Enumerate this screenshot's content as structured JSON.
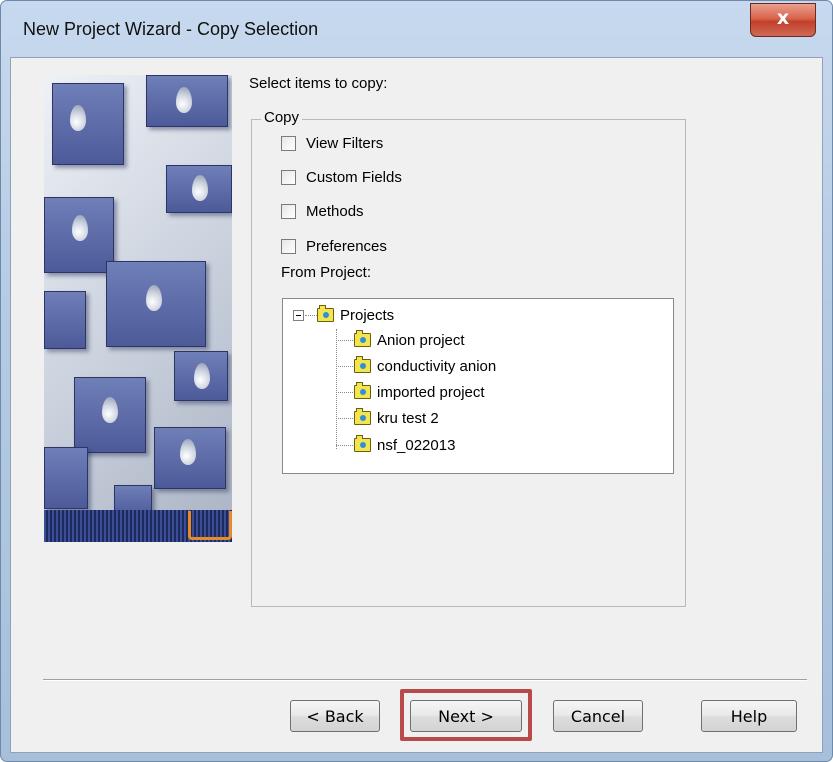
{
  "window": {
    "title": "New Project Wizard - Copy Selection",
    "close_glyph": "x"
  },
  "prompt": "Select items to copy:",
  "copy_group": {
    "legend": "Copy",
    "options": [
      {
        "label": "View Filters",
        "checked": false
      },
      {
        "label": "Custom Fields",
        "checked": false
      },
      {
        "label": "Methods",
        "checked": false
      },
      {
        "label": "Preferences",
        "checked": false
      }
    ]
  },
  "from_project": {
    "label": "From Project:",
    "root": "Projects",
    "children": [
      "Anion project",
      "conductivity anion",
      "imported project",
      "kru test 2",
      "nsf_022013"
    ]
  },
  "buttons": {
    "back": "< Back",
    "next": "Next >",
    "cancel": "Cancel",
    "help": "Help"
  },
  "icons": {
    "close": "close-icon",
    "folder": "folder-icon",
    "expander": "collapse-icon"
  },
  "colors": {
    "highlight": "#b84a4a",
    "folder": "#f4e44e",
    "close_button": "#c2402b"
  }
}
